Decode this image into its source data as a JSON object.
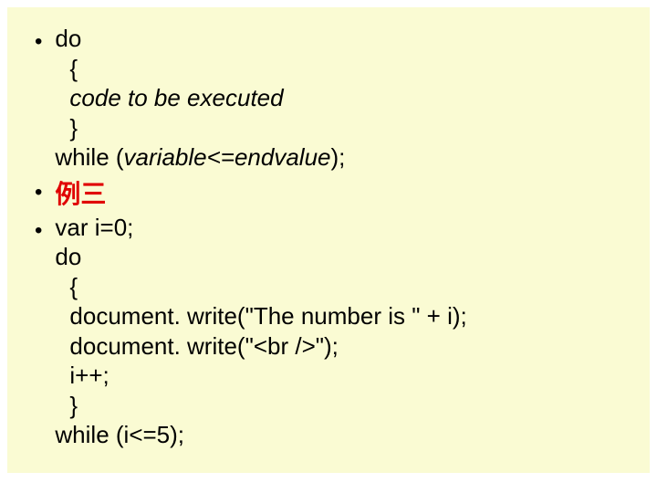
{
  "item1": {
    "line1": "do",
    "line2": "{",
    "line3_prefix": "code to be executed",
    "line4": "}",
    "line5_prefix": "while (",
    "line5_var": "variable<=endvalue",
    "line5_suffix": ");"
  },
  "item2": {
    "label": "例三"
  },
  "item3": {
    "line1": "var i=0;",
    "line2": "do",
    "line3": "{",
    "line4": "document. write(\"The number is \" + i);",
    "line5": "document. write(\"<br />\");",
    "line6": "i++;",
    "line7": "}",
    "line8": "while (i<=5);"
  }
}
